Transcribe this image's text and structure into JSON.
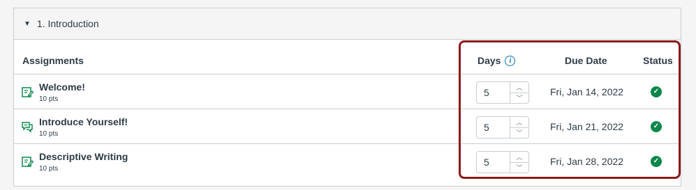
{
  "module": {
    "title": "1. Introduction",
    "caret_icon": "caret-down-icon"
  },
  "table": {
    "headers": {
      "assignments": "Assignments",
      "days": "Days",
      "due_date": "Due Date",
      "status": "Status"
    },
    "info_icon": "info-icon",
    "rows": [
      {
        "title": "Welcome!",
        "points": "10 pts",
        "icon": "assignment-icon",
        "days": "5",
        "due_date": "Fri, Jan 14, 2022",
        "status": "complete"
      },
      {
        "title": "Introduce Yourself!",
        "points": "10 pts",
        "icon": "discussion-icon",
        "days": "5",
        "due_date": "Fri, Jan 21, 2022",
        "status": "complete"
      },
      {
        "title": "Descriptive Writing",
        "points": "10 pts",
        "icon": "assignment-icon",
        "days": "5",
        "due_date": "Fri, Jan 28, 2022",
        "status": "complete"
      }
    ]
  },
  "colors": {
    "icon_green": "#0b874b",
    "info_blue": "#0374b5",
    "highlight_red": "#8b1a1a"
  }
}
